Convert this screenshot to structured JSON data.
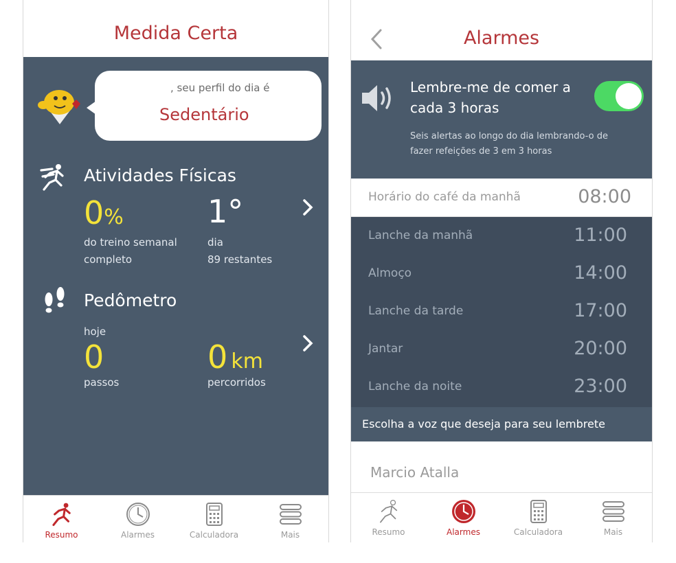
{
  "left": {
    "title": "Medida Certa",
    "profile": {
      "greeting": ", seu perfil do dia é",
      "status": "Sedentário"
    },
    "activities": {
      "title": "Atividades Físicas",
      "percent_value": "0",
      "percent_unit": "%",
      "percent_label_1": "do treino semanal",
      "percent_label_2": "completo",
      "day_value": "1°",
      "day_label_1": "dia",
      "day_label_2": "89 restantes"
    },
    "pedometer": {
      "title": "Pedômetro",
      "today_label": "hoje",
      "steps_value": "0",
      "steps_label": "passos",
      "km_value": "0",
      "km_unit": "km",
      "km_label": "percorridos"
    }
  },
  "right": {
    "title": "Alarmes",
    "reminder": {
      "title_1": "Lembre-me de comer a",
      "title_2": "cada 3 horas",
      "desc_1": "Seis alertas ao longo do dia lembrando-o de",
      "desc_2": "fazer refeições de 3 em 3 horas",
      "enabled": true
    },
    "breakfast": {
      "label": "Horário do café da manhã",
      "time": "08:00"
    },
    "meals": [
      {
        "label": "Lanche da manhã",
        "time": "11:00"
      },
      {
        "label": "Almoço",
        "time": "14:00"
      },
      {
        "label": "Lanche da tarde",
        "time": "17:00"
      },
      {
        "label": "Jantar",
        "time": "20:00"
      },
      {
        "label": "Lanche da noite",
        "time": "23:00"
      }
    ],
    "voice_header": "Escolha a voz que deseja para seu lembrete",
    "voice_name": "Marcio Atalla"
  },
  "tabs": [
    {
      "label": "Resumo",
      "icon": "runner-icon"
    },
    {
      "label": "Alarmes",
      "icon": "clock-icon"
    },
    {
      "label": "Calculadora",
      "icon": "calculator-icon"
    },
    {
      "label": "Mais",
      "icon": "menu-icon"
    }
  ],
  "colors": {
    "accent": "#b5363a",
    "panel": "#4a5a6b",
    "panel_dark": "#3f4c5c",
    "highlight": "#f4e33a",
    "toggle_on": "#4cd964"
  }
}
